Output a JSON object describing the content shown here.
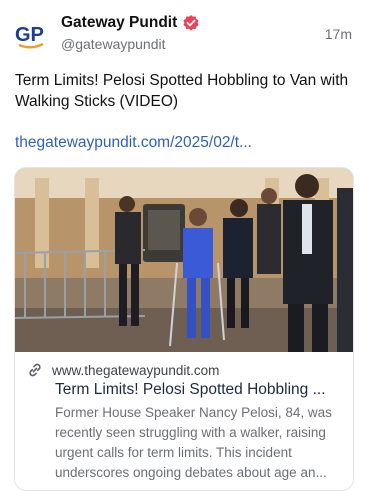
{
  "account": {
    "logo_text": "GP",
    "name": "Gateway Pundit",
    "handle": "@gatewaypundit",
    "time_ago": "17m",
    "verified_icon": "verified-badge-icon"
  },
  "post": {
    "text": "Term Limits! Pelosi Spotted Hobbling to Van with Walking Sticks (VIDEO)",
    "link_text": "thegatewaypundit.com/2025/02/t..."
  },
  "card": {
    "domain": "www.thegatewaypundit.com",
    "title": "Term Limits! Pelosi Spotted Hobbling ...",
    "description": "Former House Speaker Nancy Pelosi, 84, was recently seen struggling with a walker, raising urgent calls for term limits. This incident underscores ongoing debates about age an...",
    "link_icon": "link-icon"
  },
  "colors": {
    "link": "#2f5fb8",
    "verified": "#e9445a",
    "logo_blue": "#1a3e8c",
    "logo_orange": "#e8a02a"
  }
}
